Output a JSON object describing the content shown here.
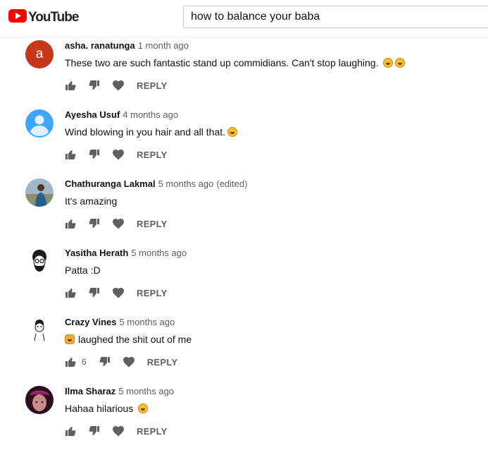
{
  "header": {
    "logo_text": "YouTube",
    "search_value": "how to balance your baba"
  },
  "comments": [
    {
      "author": "asha. ranatunga",
      "time": "1 month ago",
      "text": "These two are such fantastic stand up commidians. Can't stop laughing.",
      "avatar_letter": "a",
      "reply": "REPLY"
    },
    {
      "author": "Ayesha Usuf",
      "time": "4 months ago",
      "text": "Wind blowing in you hair and all that.",
      "reply": "REPLY"
    },
    {
      "author": "Chathuranga Lakmal",
      "time": "5 months ago",
      "edited": "(edited)",
      "text": "It's amazing",
      "reply": "REPLY"
    },
    {
      "author": "Yasitha Herath",
      "time": "5 months ago",
      "text": "Patta :D",
      "reply": "REPLY"
    },
    {
      "author": "Crazy Vines",
      "time": "5 months ago",
      "text": "laughed the shit out of me",
      "like_count": "6",
      "reply": "REPLY"
    },
    {
      "author": "Ilma Sharaz",
      "time": "5 months ago",
      "text": "Hahaa hilarious",
      "reply": "REPLY"
    }
  ],
  "icons": {
    "like": "thumb-up-icon",
    "dislike": "thumb-down-icon",
    "heart": "heart-icon",
    "laugh_emoji": "laughing-emoji",
    "grin_emoji": "grinning-emoji",
    "cat_emoji": "grinning-cat-emoji"
  },
  "colors": {
    "brand_red": "#ff0000",
    "avatar_letter_bg": "#c5391a",
    "avatar_default_bg": "#3ea6ff",
    "meta_gray": "#606060"
  }
}
